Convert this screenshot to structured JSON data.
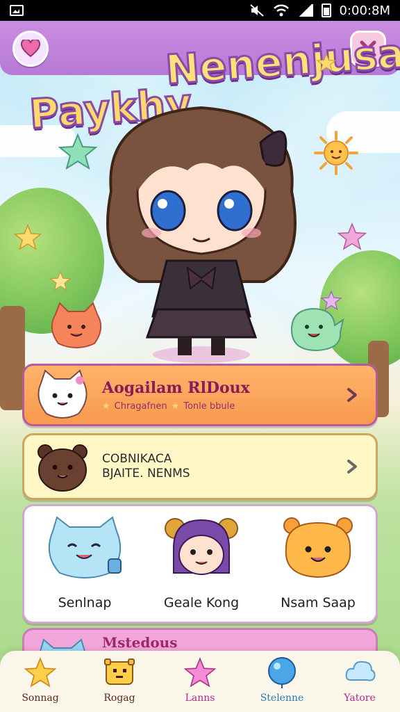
{
  "status_bar": {
    "time": "0:00:8M"
  },
  "header": {
    "title_line1": "Paykhy",
    "title_line2": "Nenenjusa!"
  },
  "cards": {
    "featured": {
      "title": "Aogailam RlDoux",
      "subtitle_left": "Chragafnen",
      "subtitle_right": "Tonle bbule"
    },
    "secondary": {
      "line1": "COBNIKACA",
      "line2": "BJAITE. NENMS"
    },
    "more": {
      "title": "Mstedous"
    }
  },
  "characters": [
    {
      "name": "Senlnap"
    },
    {
      "name": "Geale Kong"
    },
    {
      "name": "Nsam Saap"
    }
  ],
  "bottom_nav": [
    {
      "label": "Sonnag",
      "icon": "star-icon",
      "color": "#5a2a1a"
    },
    {
      "label": "Rogag",
      "icon": "robot-icon",
      "color": "#5a2a1a"
    },
    {
      "label": "Lanns",
      "icon": "pink-star-icon",
      "color": "#b0298c"
    },
    {
      "label": "Stelenne",
      "icon": "balloon-icon",
      "color": "#2a7bb5"
    },
    {
      "label": "Yatore",
      "icon": "cloud-icon",
      "color": "#b0298c"
    }
  ],
  "colors": {
    "header": "#b57ad6",
    "featured_card": "#f79a4f",
    "secondary_card": "#fff7c6",
    "more_card": "#f2a6dc"
  }
}
